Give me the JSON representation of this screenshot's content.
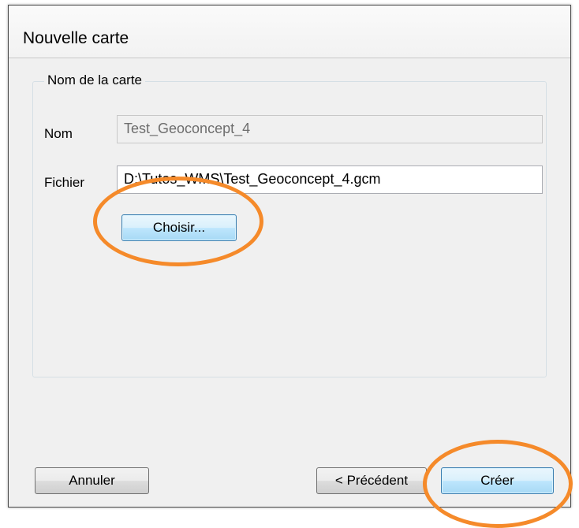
{
  "window": {
    "title": "Nouvelle carte"
  },
  "group": {
    "legend": "Nom de la carte",
    "nom_label": "Nom",
    "nom_value": "Test_Geoconcept_4",
    "fichier_label": "Fichier",
    "fichier_value": "D:\\Tutos_WMS\\Test_Geoconcept_4.gcm",
    "choose_button": "Choisir..."
  },
  "footer": {
    "cancel_button": "Annuler",
    "previous_button": "< Précédent",
    "create_button": "Créer"
  },
  "colors": {
    "highlight": "#f58a2a",
    "focus_border": "#3c7fb1"
  }
}
